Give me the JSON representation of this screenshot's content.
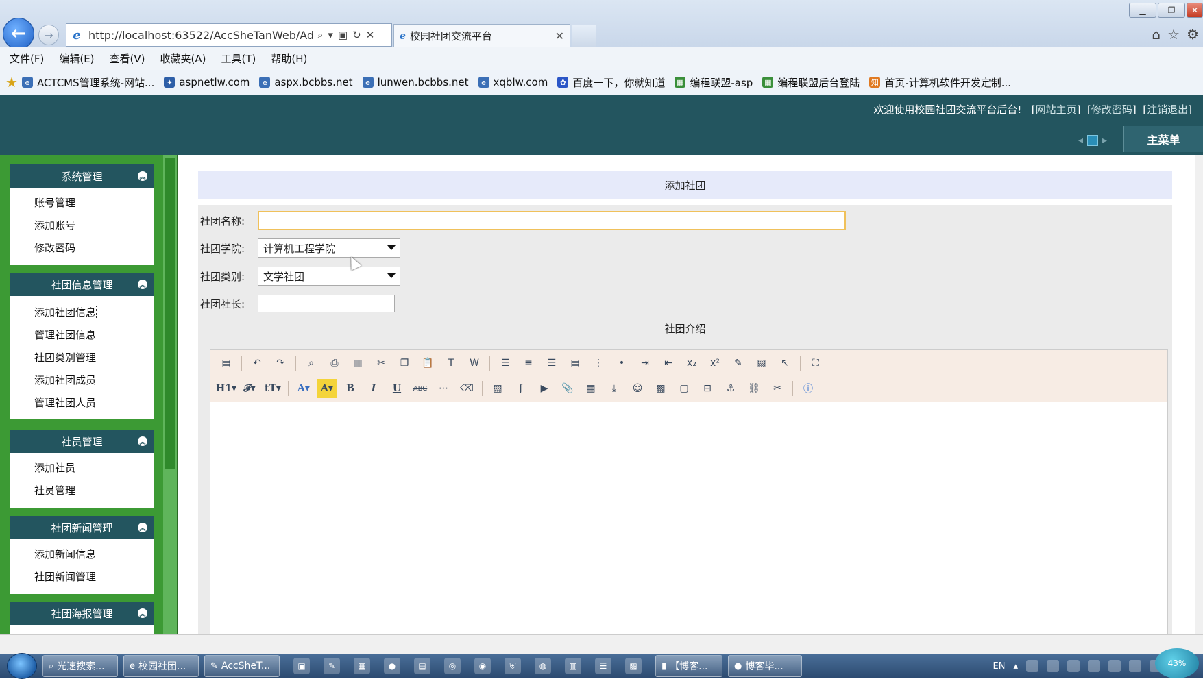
{
  "browser": {
    "url": "http://localhost:63522/AccSheTanWeb/Adm",
    "tab_title": "校园社团交流平台",
    "menu": [
      "文件(F)",
      "编辑(E)",
      "查看(V)",
      "收藏夹(A)",
      "工具(T)",
      "帮助(H)"
    ],
    "favorites": [
      {
        "label": "ACTCMS管理系统-网站...",
        "color": "#3b6fb6"
      },
      {
        "label": "aspnetlw.com",
        "color": "#2e5fa8"
      },
      {
        "label": "aspx.bcbbs.net",
        "color": "#3b6fb6"
      },
      {
        "label": "lunwen.bcbbs.net",
        "color": "#3b6fb6"
      },
      {
        "label": "xqblw.com",
        "color": "#3b6fb6"
      },
      {
        "label": "百度一下，你就知道",
        "color": "#2b56c7"
      },
      {
        "label": "编程联盟-asp",
        "color": "#3a8f3a"
      },
      {
        "label": "编程联盟后台登陆",
        "color": "#3a8f3a"
      },
      {
        "label": "首页-计算机软件开发定制...",
        "color": "#e07a22"
      }
    ]
  },
  "header": {
    "welcome": "欢迎使用校园社团交流平台后台!",
    "links": [
      "网站主页",
      "修改密码",
      "注销退出"
    ],
    "main_menu": "主菜单"
  },
  "sidebar": {
    "panels": [
      {
        "title": "系统管理",
        "items": [
          "账号管理",
          "添加账号",
          "修改密码"
        ]
      },
      {
        "title": "社团信息管理",
        "items": [
          "添加社团信息",
          "管理社团信息",
          "社团类别管理",
          "添加社团成员",
          "管理社团人员"
        ]
      },
      {
        "title": "社员管理",
        "items": [
          "添加社员",
          "社员管理"
        ]
      },
      {
        "title": "社团新闻管理",
        "items": [
          "添加新闻信息",
          "社团新闻管理"
        ]
      },
      {
        "title": "社团海报管理",
        "items": []
      }
    ]
  },
  "form": {
    "title": "添加社团",
    "name_label": "社团名称:",
    "name_value": "",
    "college_label": "社团学院:",
    "college_value": "计算机工程学院",
    "category_label": "社团类别:",
    "category_value": "文学社团",
    "leader_label": "社团社长:",
    "leader_value": "",
    "intro_label": "社团介绍"
  },
  "editor": {
    "row1": [
      "source-icon",
      "undo-icon",
      "redo-icon",
      "|",
      "preview-icon",
      "print-icon",
      "template-icon",
      "cut-icon",
      "copy-icon",
      "paste-icon",
      "paste-text-icon",
      "paste-word-icon",
      "|",
      "align-left-icon",
      "align-center-icon",
      "align-right-icon",
      "justify-icon",
      "ordered-list-icon",
      "unordered-list-icon",
      "indent-icon",
      "outdent-icon",
      "subscript-icon",
      "superscript-icon",
      "clear-format-icon",
      "select-all-icon",
      "select-icon",
      "|",
      "fullscreen-icon"
    ],
    "row2": [
      "H1",
      "F",
      "tT",
      "|",
      "A",
      "A",
      "B",
      "I",
      "U",
      "ABC",
      "|",
      "hr-icon",
      "eraser-icon",
      "|",
      "image-icon",
      "flash-icon",
      "media-icon",
      "attach-icon",
      "table-icon",
      "insert-icon",
      "emoticon-icon",
      "map-icon",
      "code-icon",
      "pagebreak-icon",
      "anchor-icon",
      "link-icon",
      "unlink-icon",
      "|",
      "help-icon"
    ]
  },
  "taskbar": {
    "buttons": [
      {
        "label": "光速搜索..."
      },
      {
        "label": "校园社团..."
      },
      {
        "label": "AccSheT..."
      }
    ],
    "pinned": [
      "【博客...",
      "博客毕..."
    ],
    "lang": "EN",
    "zoom": "43%"
  }
}
